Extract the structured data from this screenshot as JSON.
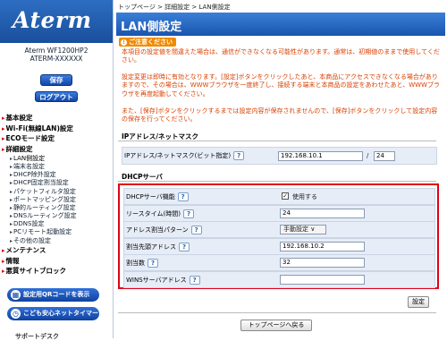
{
  "sidebar": {
    "logo": "Aterm",
    "model": "Aterm WF1200HP2",
    "device": "ATERM-XXXXXX",
    "save_label": "保存",
    "logout_label": "ログアウト",
    "menu": [
      {
        "label": "基本設定",
        "type": "sec"
      },
      {
        "label": "Wi-Fi(無線LAN)設定",
        "type": "sec"
      },
      {
        "label": "ECOモード設定",
        "type": "sec"
      },
      {
        "label": "詳細設定",
        "type": "sec"
      },
      {
        "label": "LAN側設定",
        "type": "sub",
        "active": true
      },
      {
        "label": "端末名設定",
        "type": "sub"
      },
      {
        "label": "DHCP除外設定",
        "type": "sub"
      },
      {
        "label": "DHCP固定割当設定",
        "type": "sub"
      },
      {
        "label": "パケットフィルタ設定",
        "type": "sub"
      },
      {
        "label": "ポートマッピング設定",
        "type": "sub"
      },
      {
        "label": "静的ルーティング設定",
        "type": "sub"
      },
      {
        "label": "DNSルーティング設定",
        "type": "sub"
      },
      {
        "label": "DDNS設定",
        "type": "sub"
      },
      {
        "label": "PCリモート起動設定",
        "type": "sub"
      },
      {
        "label": "その他の設定",
        "type": "sub"
      },
      {
        "label": "メンテナンス",
        "type": "sec"
      },
      {
        "label": "情報",
        "type": "sec"
      },
      {
        "label": "悪質サイトブロック",
        "type": "sec"
      }
    ],
    "qr_button": "設定用QRコードを表示",
    "kids_button": "こども安心ネットタイマー",
    "support": "サポートデスク"
  },
  "breadcrumb": "トップページ > 詳細設定 > LAN側設定",
  "page_title": "LAN側設定",
  "notice": {
    "label": "ご注意ください",
    "p1": "本項目の設定値を間違えた場合は、通信ができなくなる可能性があります。通常は、初期値のままで使用してください。",
    "p2": "設定変更は即時に有効となります。[設定]ボタンをクリックしたあと、本商品にアクセスできなくなる場合がありますので、その場合は、WWWブラウザを一度終了し、接続する端末と本商品の設定をあわせたあと、WWWブラウザを再度起動してください。",
    "p3": "また、[保存]ボタンをクリックするまでは設定内容が保存されませんので、[保存]ボタンをクリックして設定内容の保存を行ってください。"
  },
  "ip_section": {
    "header": "IPアドレス/ネットマスク",
    "label": "IPアドレス/ネットマスク(ビット指定)",
    "ip": "192.168.10.1",
    "sep": "/",
    "mask": "24"
  },
  "dhcp_section": {
    "header": "DHCPサーバ",
    "rows": [
      {
        "label": "DHCPサーバ機能",
        "value": "使用する",
        "kind": "check"
      },
      {
        "label": "リースタイム(時間)",
        "value": "24",
        "kind": "input"
      },
      {
        "label": "アドレス割当パターン",
        "value": "手動設定",
        "kind": "select"
      },
      {
        "label": "割当先頭アドレス",
        "value": "192.168.10.2",
        "kind": "input"
      },
      {
        "label": "割当数",
        "value": "32",
        "kind": "input"
      },
      {
        "label": "WINSサーバアドレス",
        "value": "",
        "kind": "input"
      }
    ],
    "help": "?"
  },
  "set_button": "設定",
  "back_button": "トップページへ戻る"
}
